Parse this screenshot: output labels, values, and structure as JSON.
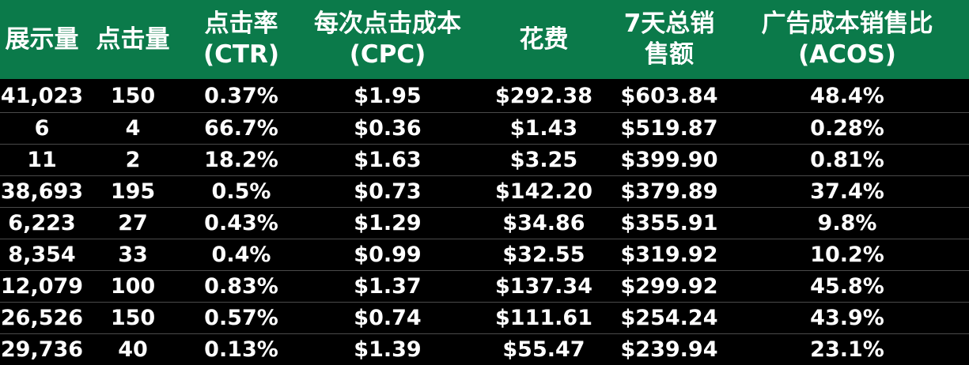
{
  "table": {
    "headers": [
      "展示量",
      "点击量",
      "点击率(CTR)",
      "每次点击成本(CPC)",
      "花费",
      "7天总销售额",
      "广告成本销售比(ACOS)"
    ],
    "rows": [
      [
        "41,023",
        "150",
        "0.37%",
        "$1.95",
        "$292.38",
        "$603.84",
        "48.4%"
      ],
      [
        "6",
        "4",
        "66.7%",
        "$0.36",
        "$1.43",
        "$519.87",
        "0.28%"
      ],
      [
        "11",
        "2",
        "18.2%",
        "$1.63",
        "$3.25",
        "$399.90",
        "0.81%"
      ],
      [
        "38,693",
        "195",
        "0.5%",
        "$0.73",
        "$142.20",
        "$379.89",
        "37.4%"
      ],
      [
        "6,223",
        "27",
        "0.43%",
        "$1.29",
        "$34.86",
        "$355.91",
        "9.8%"
      ],
      [
        "8,354",
        "33",
        "0.4%",
        "$0.99",
        "$32.55",
        "$319.92",
        "10.2%"
      ],
      [
        "12,079",
        "100",
        "0.83%",
        "$1.37",
        "$137.34",
        "$299.92",
        "45.8%"
      ],
      [
        "26,526",
        "150",
        "0.57%",
        "$0.74",
        "$111.61",
        "$254.24",
        "43.9%"
      ],
      [
        "29,736",
        "40",
        "0.13%",
        "$1.39",
        "$55.47",
        "$239.94",
        "23.1%"
      ]
    ]
  },
  "colors": {
    "header_bg": "#0b7a4a",
    "body_bg": "#000000",
    "text": "#ffffff"
  }
}
